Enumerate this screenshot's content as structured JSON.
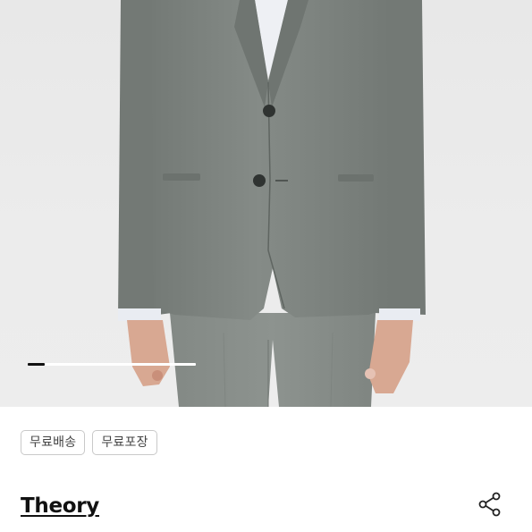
{
  "product": {
    "image_alt": "gray suit jacket and trousers",
    "carousel": {
      "current": 1,
      "progress": 0.1
    },
    "tags": [
      {
        "label": "무료배송"
      },
      {
        "label": "무료포장"
      }
    ],
    "brand": "Theory",
    "share_icon": "share-icon"
  },
  "colors": {
    "jacket": "#7e8480",
    "background": "#ebebeb",
    "brand_text": "#111111",
    "tag_border": "#c9c9c9"
  }
}
